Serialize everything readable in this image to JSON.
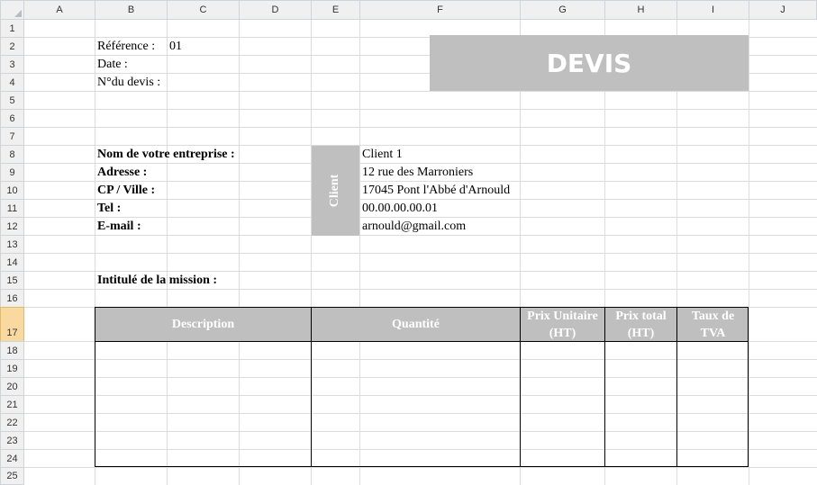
{
  "columns": [
    "A",
    "B",
    "C",
    "D",
    "E",
    "F",
    "G",
    "H",
    "I",
    "J"
  ],
  "rows": [
    "1",
    "2",
    "3",
    "4",
    "5",
    "6",
    "7",
    "8",
    "9",
    "10",
    "11",
    "12",
    "13",
    "14",
    "15",
    "16",
    "17",
    "18",
    "19",
    "20",
    "21",
    "22",
    "23",
    "24",
    "25"
  ],
  "header": {
    "reference_label": "Référence :",
    "reference_value": "01",
    "date_label": "Date :",
    "devis_number_label": "N°du devis :",
    "title": "DEVIS"
  },
  "company": {
    "name_label": "Nom de votre entreprise :",
    "address_label": "Adresse :",
    "cp_ville_label": "CP / Ville :",
    "tel_label": "Tel :",
    "email_label": "E-mail :"
  },
  "client": {
    "label": "Client",
    "name": "Client 1",
    "address": "12 rue des Marroniers",
    "cp_ville": "17045 Pont l'Abbé d'Arnould",
    "tel": "00.00.00.00.01",
    "email": "arnould@gmail.com"
  },
  "mission_label": "Intitulé de la mission :",
  "table": {
    "description": "Description",
    "quantite": "Quantité",
    "prix_unitaire_l1": "Prix Unitaire",
    "prix_unitaire_l2": "(HT)",
    "prix_total_l1": "Prix total",
    "prix_total_l2": "(HT)",
    "taux_l1": "Taux de",
    "taux_l2": "TVA"
  }
}
